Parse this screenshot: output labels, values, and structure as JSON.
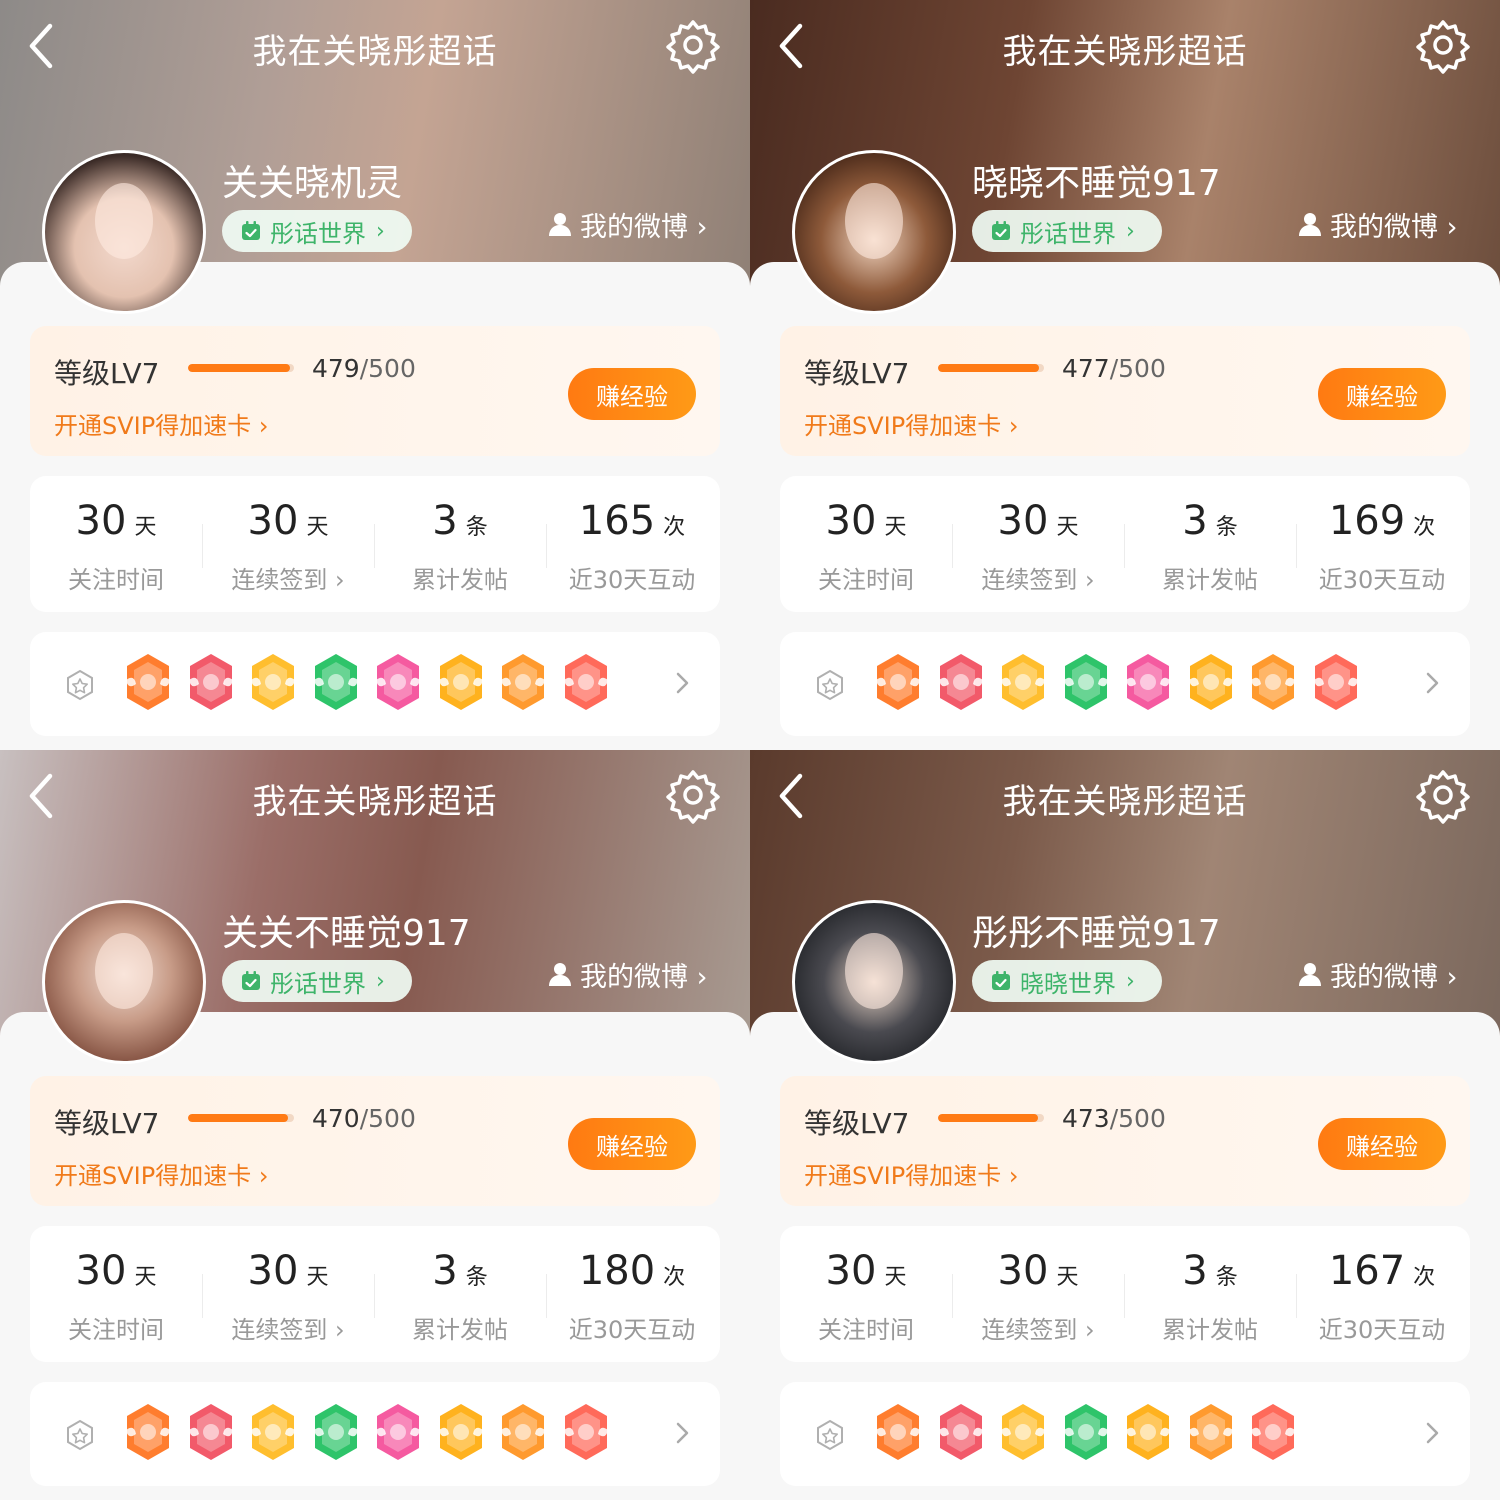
{
  "common": {
    "nav_title": "我在关晓彤超话",
    "my_weibo_label": "我的微博 ›",
    "level_label": "等级LV7",
    "level_max": "/500",
    "svip_text": "开通SVIP得加速卡 ›",
    "earn_button": "赚经验",
    "stat_units": [
      "天",
      "天",
      "条",
      "次"
    ],
    "stat_labels": [
      "关注时间",
      "连续签到 ›",
      "累计发帖",
      "近30天互动"
    ],
    "accent_color": "#ff7a12",
    "world_color": "#3eb46a"
  },
  "panels": [
    {
      "nickname": "关关晓机灵",
      "world": "彤话世界",
      "level_current": "479",
      "level_fraction": 0.958,
      "stats": [
        "30",
        "30",
        "3",
        "165"
      ],
      "badges": [
        "lv7-badge",
        "trophy-badge",
        "hi-badge",
        "hand-badge",
        "graduate-badge",
        "30-days-badge",
        "laugh-badge",
        "rock-hand-badge"
      ]
    },
    {
      "nickname": "晓晓不睡觉917",
      "world": "彤话世界",
      "level_current": "477",
      "level_fraction": 0.954,
      "stats": [
        "30",
        "30",
        "3",
        "169"
      ],
      "badges": [
        "lv7-badge",
        "trophy-badge",
        "hi-badge",
        "hand-badge",
        "graduate-badge",
        "30-days-badge",
        "laugh-badge",
        "rock-hand-badge"
      ]
    },
    {
      "nickname": "关关不睡觉917",
      "world": "彤话世界",
      "level_current": "470",
      "level_fraction": 0.94,
      "stats": [
        "30",
        "30",
        "3",
        "180"
      ],
      "badges": [
        "lv7-badge",
        "trophy-badge",
        "hi-badge",
        "hand-badge",
        "graduate-badge",
        "30-days-badge",
        "laugh-badge",
        "rock-hand-badge"
      ]
    },
    {
      "nickname": "彤彤不睡觉917",
      "world": "晓晓世界",
      "level_current": "473",
      "level_fraction": 0.946,
      "stats": [
        "30",
        "30",
        "3",
        "167"
      ],
      "badges": [
        "lv7-badge",
        "trophy-badge",
        "hi-badge",
        "hand-badge",
        "30-days-badge",
        "laugh-badge",
        "rock-hand-badge"
      ]
    }
  ],
  "badge_colors": {
    "lv7-badge": "#ff7d2e",
    "trophy-badge": "#f25a6a",
    "hi-badge": "#ffbe2e",
    "hand-badge": "#2ec46a",
    "graduate-badge": "#f55aa0",
    "30-days-badge": "#ffb21e",
    "laugh-badge": "#ff9a2e",
    "rock-hand-badge": "#ff6a5a"
  }
}
